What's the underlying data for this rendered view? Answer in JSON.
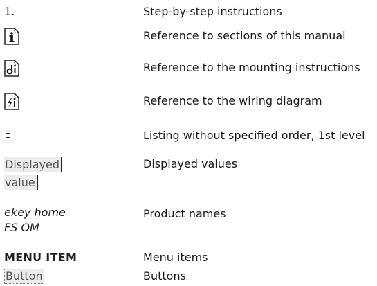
{
  "rows": {
    "step": {
      "symbol": "1.",
      "text": "Step-by-step instructions"
    },
    "manual_ref": {
      "icon": "info-document-icon",
      "text": "Reference to sections of this manual"
    },
    "mounting_ref": {
      "icon": "tools-document-icon",
      "text": "Reference to the mounting instructions"
    },
    "wiring_ref": {
      "icon": "lightning-document-icon",
      "text": "Reference to the wiring diagram"
    },
    "listing": {
      "icon": "square-bullet-icon",
      "text": "Listing without specified order, 1st level"
    },
    "displayed": {
      "symbol_line1": "Displayed",
      "symbol_line2": "value",
      "text": "Displayed values"
    },
    "product": {
      "symbol_line1": "ekey home",
      "symbol_line2": "FS OM",
      "text": "Product names"
    },
    "menu": {
      "symbol": "MENU ITEM",
      "text": "Menu items"
    },
    "button": {
      "symbol": "Button",
      "text": "Buttons"
    }
  }
}
